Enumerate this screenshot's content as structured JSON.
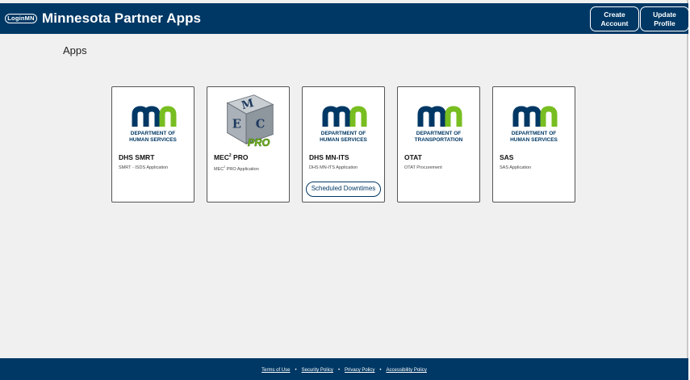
{
  "header": {
    "logo_text": "LoginMN",
    "title": "Minnesota Partner Apps",
    "create_account": [
      "Create",
      "Account"
    ],
    "update_profile": [
      "Update",
      "Profile"
    ]
  },
  "main": {
    "heading": "Apps",
    "cards": [
      {
        "logo": "mn-dhs-logo",
        "logo_lines": [
          "DEPARTMENT OF",
          "HUMAN SERVICES"
        ],
        "title": "DHS SMRT",
        "subtitle": "SMRT - ISDS Application"
      },
      {
        "logo": "mec2-pro-cube-logo",
        "logo_lines": [
          "M",
          "E",
          "C",
          "PRO"
        ],
        "title": "MEC",
        "title_sup": "2",
        "title_rest": " PRO",
        "subtitle": "MEC",
        "subtitle_sup": "2",
        "subtitle_rest": " PRO Application"
      },
      {
        "logo": "mn-dhs-logo",
        "logo_lines": [
          "DEPARTMENT OF",
          "HUMAN SERVICES"
        ],
        "title": "DHS MN-ITS",
        "subtitle": "DHS MN-ITS Application",
        "button": "Scheduled Downtimes"
      },
      {
        "logo": "mn-dot-logo",
        "logo_lines": [
          "DEPARTMENT OF",
          "TRANSPORTATION"
        ],
        "title": "OTAT",
        "subtitle": "OTAT Procurement"
      },
      {
        "logo": "mn-dhs-logo",
        "logo_lines": [
          "DEPARTMENT OF",
          "HUMAN SERVICES"
        ],
        "title": "SAS",
        "subtitle": "SAS Application"
      }
    ]
  },
  "footer": {
    "links": [
      "Terms of Use",
      "Security Policy",
      "Privacy Policy",
      "Accessibility Policy"
    ],
    "separator": "•"
  },
  "colors": {
    "brand_navy": "#003865",
    "mn_green": "#78be21",
    "background": "#f0f0f0"
  }
}
